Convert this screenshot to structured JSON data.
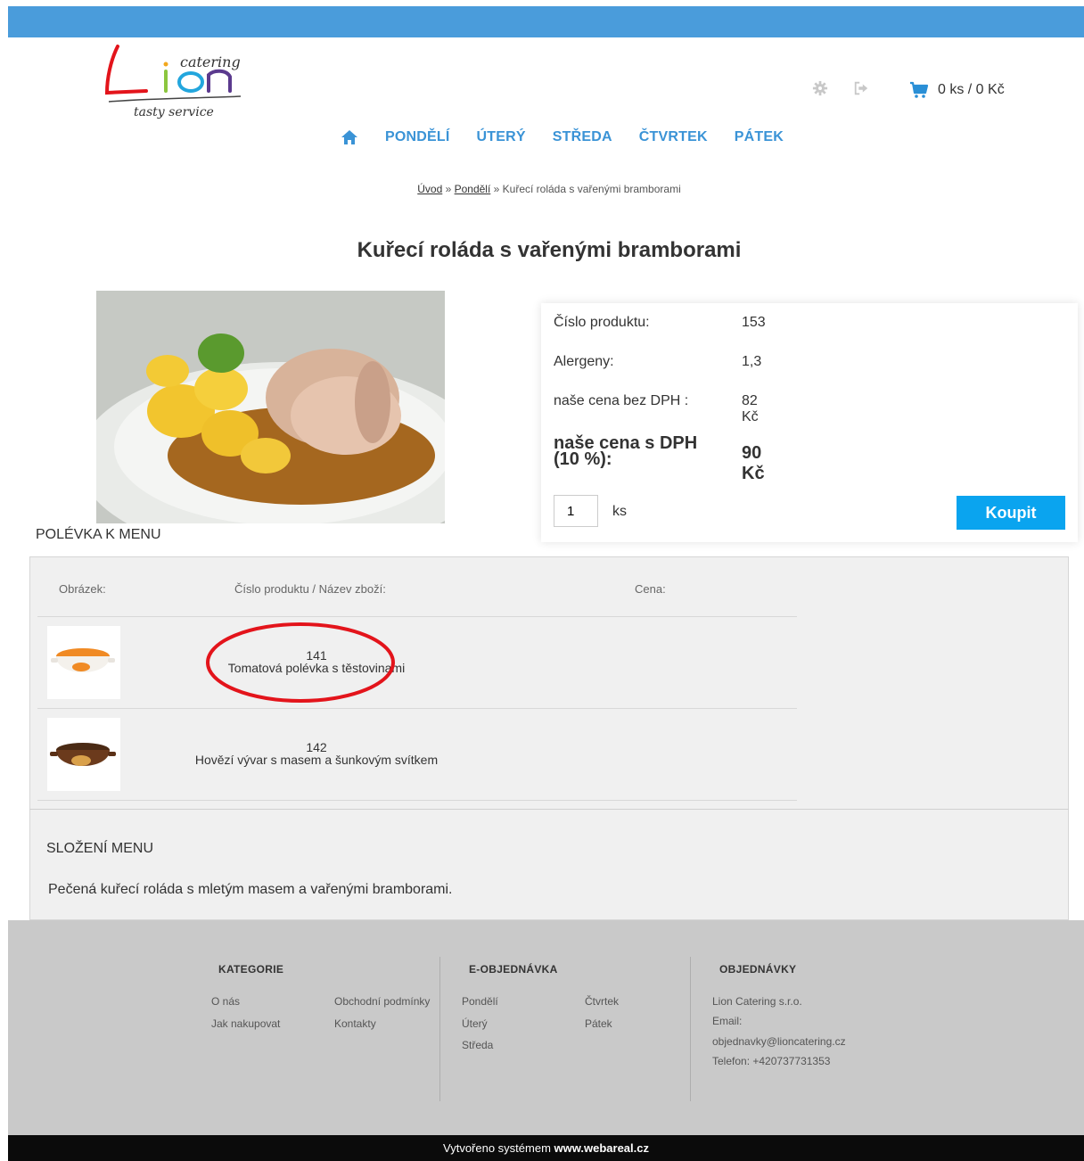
{
  "logo": {
    "word": "Lion",
    "top_text": "catering",
    "bottom_text": "tasty service"
  },
  "cart": {
    "summary": "0 ks / 0 Kč"
  },
  "nav": {
    "items": [
      "PONDĚLÍ",
      "ÚTERÝ",
      "STŘEDA",
      "ČTVRTEK",
      "PÁTEK"
    ]
  },
  "breadcrumb": {
    "home": "Úvod",
    "sep": " » ",
    "category": "Pondělí",
    "current": "Kuřecí roláda s vařenými bramborami"
  },
  "product": {
    "title": "Kuřecí roláda s vařenými bramborami",
    "number_label": "Číslo produktu:",
    "number_value": "153",
    "allergens_label": "Alergeny:",
    "allergens_value": "1,3",
    "price_net_label": "naše cena bez DPH :",
    "price_net_value": "82 Kč",
    "price_gross_label": "naše cena s DPH (10 %):",
    "price_gross_value": "90 Kč",
    "quantity": "1",
    "quantity_unit": "ks",
    "buy_label": "Koupit"
  },
  "soup": {
    "heading": "POLÉVKA K MENU",
    "columns": [
      "Obrázek:",
      "Číslo produktu / Název zboží:",
      "Cena:"
    ],
    "rows": [
      {
        "number": "141",
        "name": "Tomatová polévka s těstovinami",
        "icon": "soup-bowl-orange-icon"
      },
      {
        "number": "142",
        "name": "Hovězí vývar s masem a šunkovým svítkem",
        "icon": "soup-bowl-brown-icon"
      }
    ]
  },
  "composition": {
    "heading": "SLOŽENÍ MENU",
    "text": "Pečená kuřecí roláda s mletým masem a vařenými bramborami."
  },
  "footer": {
    "categories": {
      "title": "KATEGORIE",
      "links": [
        "O nás",
        "Obchodní podmínky",
        "Jak nakupovat",
        "Kontakty"
      ]
    },
    "eorder": {
      "title": "E-OBJEDNÁVKA",
      "links": [
        "Pondělí",
        "Čtvrtek",
        "Úterý",
        "Pátek",
        "Středa"
      ]
    },
    "orders": {
      "title": "OBJEDNÁVKY",
      "company": "Lion Catering s.r.o.",
      "email_label": "Email:",
      "email": "objednavky@lioncatering.cz",
      "phone": "Telefon: +420737731353"
    },
    "credit_prefix": "Vytvořeno systémem ",
    "credit_site": "www.webareal.cz"
  },
  "colors": {
    "topbar": "#4a9cdb",
    "nav": "#3a93d6",
    "buy": "#0aa4ef",
    "footer": "#c9c9c9",
    "annotation": "#e3141b"
  }
}
